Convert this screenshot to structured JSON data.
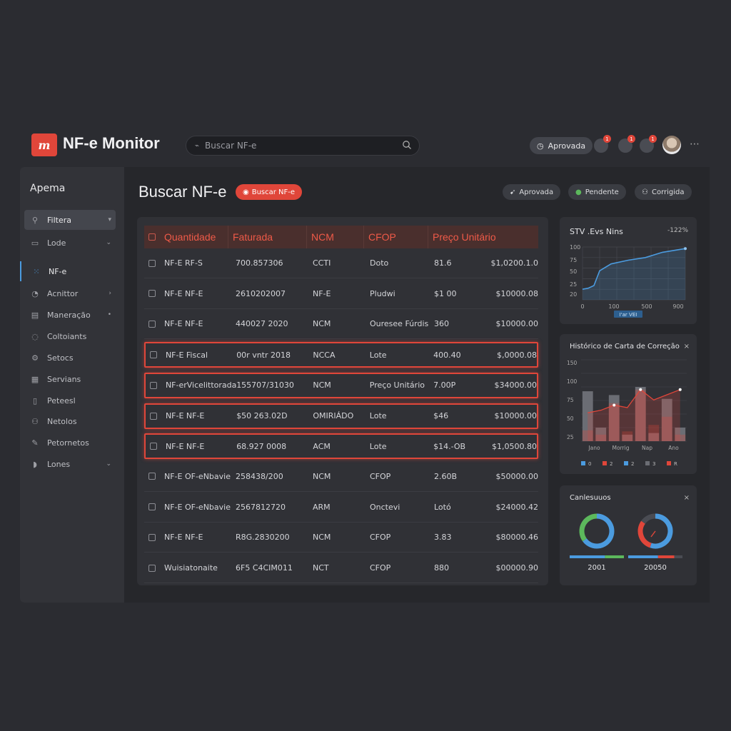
{
  "app": {
    "logo": "m",
    "title": "NF-e Monitor"
  },
  "search": {
    "placeholder": "Buscar NF-e"
  },
  "topbar": {
    "status_button": "Aprovada",
    "badges": [
      "1",
      "1",
      "1"
    ],
    "icons": [
      "search-icon",
      "bell-icon",
      "chat-icon",
      "settings-icon",
      "avatar",
      "more-icon"
    ]
  },
  "sidebar": {
    "heading": "Apema",
    "items": [
      {
        "label": "Filtera",
        "icon": "search-icon"
      },
      {
        "label": "Lode",
        "icon": "layers-icon"
      },
      {
        "label": "NF-e",
        "icon": "grid-icon"
      },
      {
        "label": "Acnittor",
        "icon": "user-icon"
      },
      {
        "label": "Maneração",
        "icon": "table-icon"
      },
      {
        "label": "Coltoiants",
        "icon": "pin-icon"
      },
      {
        "label": "Setocs",
        "icon": "gear-icon"
      },
      {
        "label": "Servians",
        "icon": "calendar-icon"
      },
      {
        "label": "Peteesl",
        "icon": "document-icon"
      },
      {
        "label": "Netolos",
        "icon": "people-icon"
      },
      {
        "label": "Petornetos",
        "icon": "edit-icon"
      },
      {
        "label": "Lones",
        "icon": "bell-icon"
      }
    ]
  },
  "main": {
    "title": "Buscar NF-e",
    "title_pill": "Buscar NF-e",
    "status_pills": [
      "Aprovada",
      "Pendente",
      "Corrigida"
    ]
  },
  "table": {
    "headers": [
      "Quantidade",
      "Faturada",
      "NCM",
      "CFOP",
      "Preço Unitário"
    ],
    "rows": [
      [
        "NF-E RF-S",
        "700.857306",
        "CCTI",
        "Doto",
        "81.6",
        "$1,0200.1.0"
      ],
      [
        "NF-E NF-E",
        "2610202007",
        "NF-E",
        "Pludwi",
        "$1 00",
        "$10000.08"
      ],
      [
        "NF-E NF-E",
        "440027 2020",
        "NCM",
        "Ouresee Fúrdis",
        "360",
        "$10000.00"
      ],
      [
        "NF-E Fiscal",
        "00r vntr 2018",
        "NCCA",
        "Lote",
        "400.40",
        "$,0000.08"
      ],
      [
        "NF-erVicelittorada",
        "155707/31030",
        "NCM",
        "Preço Unitário",
        "7.00P",
        "$34000.00"
      ],
      [
        "NF-E NF-E",
        "$50 263.02D",
        "OMIRIÁDO",
        "Lote",
        "$46",
        "$10000.00"
      ],
      [
        "NF-E NF-E",
        "68.927 0008",
        "ACM",
        "Lote",
        "$14.-OB",
        "$1,0500.80"
      ],
      [
        "NF-E OF-eNbavie",
        "258438/200",
        "NCM",
        "CFOP",
        "2.60B",
        "$50000.00"
      ],
      [
        "NF-E OF-eNbavie",
        "2567812720",
        "ARM",
        "Onctevi",
        "Lotó",
        "$24000.42"
      ],
      [
        "NF-E NF-E",
        "R8G.2830200",
        "NCM",
        "CFOP",
        "3.83",
        "$80000.46"
      ],
      [
        "Wuisiatonaite",
        "6F5 C4CIM011",
        "NCT",
        "CFOP",
        "880",
        "$00000.90"
      ]
    ],
    "highlighted_rows": [
      3,
      4,
      5,
      6
    ]
  },
  "cards": {
    "line_title": "STV .Evs Nins",
    "line_value": "-122%",
    "line_legend": "I'ar VEI",
    "bar_title": "Histórico de Carta de Correção",
    "bar_legend": [
      "0",
      "2",
      "2",
      "3",
      "R"
    ],
    "donut_title": "Canlesuuos",
    "donut_labels": [
      "2001",
      "20050"
    ],
    "close_icon": "×"
  },
  "colors": {
    "accent": "#e0463a",
    "blue": "#4b9bdf",
    "green": "#5cb85c"
  },
  "chart_data": [
    {
      "type": "line",
      "title": "STV .Evs Nins",
      "x": [
        0,
        100,
        500,
        900
      ],
      "x_ticks": [
        "0",
        "100",
        "500",
        "900"
      ],
      "y_ticks": [
        "20",
        "25",
        "50",
        "75",
        "100"
      ],
      "series": [
        {
          "values": [
            [
              0,
              20
            ],
            [
              50,
              22
            ],
            [
              100,
              27
            ],
            [
              150,
              55
            ],
            [
              250,
              68
            ],
            [
              400,
              75
            ],
            [
              550,
              80
            ],
            [
              700,
              90
            ],
            [
              900,
              97
            ]
          ]
        }
      ],
      "ylim": [
        0,
        100
      ]
    },
    {
      "type": "bar",
      "title": "Histórico de Carta de Correção",
      "categories": [
        "Jano",
        "",
        "Morrig",
        "",
        "Nap",
        "",
        "Ano",
        ""
      ],
      "y_ticks": [
        "25",
        "50",
        "75",
        "100",
        "150"
      ],
      "series": [
        {
          "values": [
            92,
            25,
            85,
            12,
            100,
            15,
            78,
            25
          ]
        },
        {
          "values": [
            20,
            12,
            70,
            18,
            95,
            30,
            45,
            12
          ]
        }
      ],
      "line": [
        55,
        60,
        70,
        65,
        100,
        80,
        90,
        100
      ],
      "ylim": [
        0,
        150
      ]
    },
    {
      "type": "pie",
      "title": "Canlesuuos",
      "charts": [
        {
          "label": "2001",
          "slices": [
            {
              "name": "blue",
              "value": 65
            },
            {
              "name": "green",
              "value": 35
            }
          ]
        },
        {
          "label": "20050",
          "slices": [
            {
              "name": "blue",
              "value": 55
            },
            {
              "name": "red",
              "value": 30
            },
            {
              "name": "dark",
              "value": 15
            }
          ]
        }
      ]
    }
  ]
}
